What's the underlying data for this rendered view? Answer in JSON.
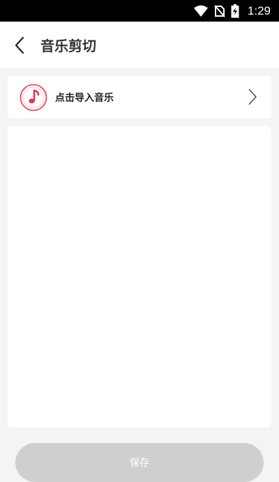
{
  "status_bar": {
    "time": "1:29",
    "icons": [
      "wifi-icon",
      "no-sim-icon",
      "battery-charging-icon"
    ]
  },
  "app_bar": {
    "back_icon": "chevron-left-icon",
    "title": "音乐剪切"
  },
  "import_card": {
    "icon": "music-note-icon",
    "label": "点击导入音乐",
    "arrow_icon": "chevron-right-icon"
  },
  "save_button": {
    "label": "保存"
  },
  "colors": {
    "accent": "#e8324f",
    "background": "#f4f4f4",
    "button_disabled": "#cfcfcf"
  }
}
